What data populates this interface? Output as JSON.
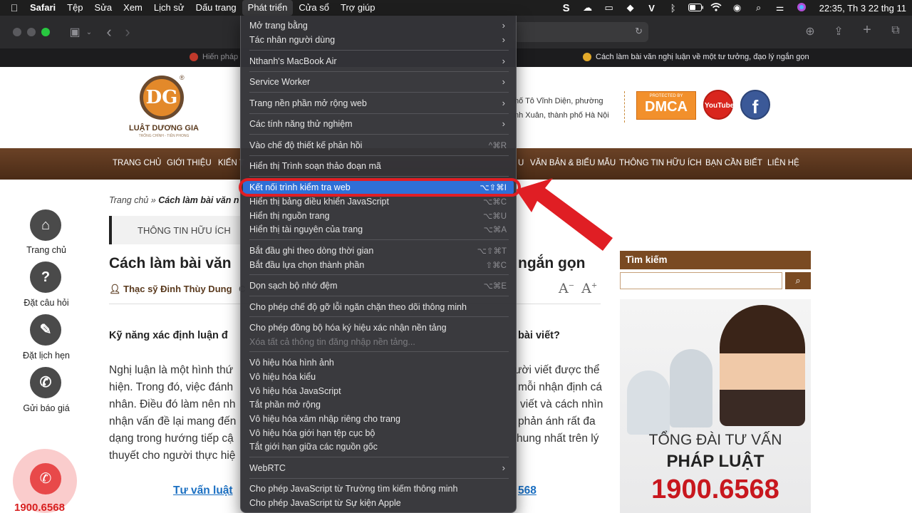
{
  "menubar": {
    "app": "Safari",
    "items": [
      "Tệp",
      "Sửa",
      "Xem",
      "Lịch sử",
      "Dấu trang",
      "Phát triển",
      "Cửa sổ",
      "Trợ giúp"
    ],
    "active": "Phát triển",
    "clock": "22:35, Th 3 22 thg 11",
    "status_icons": [
      "s-icon",
      "creative-cloud-icon",
      "notification-icon",
      "dropbox-icon",
      "v-icon",
      "bluetooth-icon",
      "battery-icon",
      "wifi-icon",
      "user-icon",
      "search-icon",
      "control-center-icon",
      "siri-icon"
    ]
  },
  "tabs": {
    "tab1": "Hiến pháp",
    "tab2": "Cách làm bài văn nghị luận về một tư tưởng, đạo lý ngắn gọn"
  },
  "header": {
    "logo_name": "LUẬT DƯƠNG GIA",
    "logo_tagline": "TRỐNG CHÍNH - TIÊN PHONG",
    "logo_reg": "®",
    "address_line1": "hố Tô Vĩnh Diện, phường",
    "address_line2": "nh Xuân, thành phố Hà Nội",
    "dmca_top": "PROTECTED BY",
    "dmca": "DMCA",
    "youtube": "YouTube",
    "facebook": "f"
  },
  "nav": {
    "items": [
      "TRANG CHỦ",
      "GIỚI THIỆU",
      "KIẾN T",
      "U",
      "VĂN BẢN & BIỂU MẪU",
      "THÔNG TIN HỮU ÍCH",
      "BẠN CẦN BIẾT",
      "LIÊN HỆ"
    ]
  },
  "left_sidebar": {
    "home": "Trang chủ",
    "ask": "Đặt câu hỏi",
    "appointment": "Đặt lịch hẹn",
    "quote": "Gửi báo giá",
    "phone": "1900.6568"
  },
  "article": {
    "breadcrumb_home": "Trang chủ »",
    "breadcrumb_current": "Cách làm bài văn n",
    "category": "THÔNG TIN HỮU ÍCH",
    "title_left": "Cách làm bài văn",
    "title_right": "ngắn gọn",
    "author": "Thạc sỹ Đinh Thùy Dung",
    "author_rest": "C",
    "font_small": "A",
    "font_large": "A",
    "question_left": "Kỹ năng xác định luận đ",
    "question_right": "bài viết?",
    "para_left": [
      "Nghị luận là một hình thứ",
      "hiện. Trong đó, việc đánh",
      "nhân. Điều đó làm nên nh",
      "nhận vấn đề lại mang đến",
      "dạng trong hướng tiếp cậ",
      "thuyết cho người thực hiệ"
    ],
    "para_right": [
      "ười viết được thể",
      "mỗi nhận định cá",
      "viết và cách nhìn",
      "phản ánh rất đa",
      "hung nhất trên lý",
      ""
    ],
    "link_left": "Tư vấn luật",
    "link_right": "568"
  },
  "right_sidebar": {
    "search_title": "Tìm kiếm",
    "search_placeholder": "",
    "ad_line1": "TỔNG ĐÀI TƯ VẤN",
    "ad_line2": "PHÁP LUẬT",
    "ad_line3": "1900.6568"
  },
  "dropdown": {
    "items": [
      {
        "label": "Mở trang bằng",
        "submenu": true
      },
      {
        "label": "Tác nhân người dùng",
        "submenu": true
      },
      {
        "label": "Nthanh's MacBook Air",
        "submenu": true
      },
      {
        "label": "Service Worker",
        "submenu": true
      },
      {
        "label": "Trang nền phần mở rộng web",
        "submenu": true
      },
      {
        "label": "Các tính năng thử nghiệm",
        "submenu": true
      },
      {
        "label": "Vào chế độ thiết kế phản hồi",
        "shortcut": "^⌘R"
      },
      {
        "label": "Hiển thị Trình soạn thảo đoạn mã"
      },
      {
        "label": "Kết nối trình kiểm tra web",
        "shortcut": "⌥⇧⌘I",
        "highlighted": true
      },
      {
        "label": "Hiển thị bảng điều khiển JavaScript",
        "shortcut": "⌥⌘C"
      },
      {
        "label": "Hiển thị nguồn trang",
        "shortcut": "⌥⌘U"
      },
      {
        "label": "Hiển thị tài nguyên của trang",
        "shortcut": "⌥⌘A"
      },
      {
        "label": "Bắt đầu ghi theo dòng thời gian",
        "shortcut": "⌥⇧⌘T"
      },
      {
        "label": "Bắt đầu lựa chọn thành phần",
        "shortcut": "⇧⌘C"
      },
      {
        "label": "Dọn sạch bộ nhớ đệm",
        "shortcut": "⌥⌘E"
      },
      {
        "label": "Cho phép chế độ gỡ lỗi ngăn chặn theo dõi thông minh"
      },
      {
        "label": "Cho phép đồng bộ hóa ký hiệu xác nhận nền tảng"
      },
      {
        "label": "Xóa tất cả thông tin đăng nhập nền tảng...",
        "disabled": true
      },
      {
        "label": "Vô hiệu hóa hình ảnh"
      },
      {
        "label": "Vô hiệu hóa kiểu"
      },
      {
        "label": "Vô hiệu hóa JavaScript"
      },
      {
        "label": "Tắt phần mở rộng"
      },
      {
        "label": "Vô hiệu hóa xâm nhập riêng cho trang"
      },
      {
        "label": "Vô hiệu hóa giới hạn tệp cục bộ"
      },
      {
        "label": "Tắt giới hạn giữa các nguồn gốc"
      },
      {
        "label": "WebRTC",
        "submenu": true
      },
      {
        "label": "Cho phép JavaScript từ Trường tìm kiếm thông minh"
      },
      {
        "label": "Cho phép JavaScript từ Sự kiện Apple"
      }
    ]
  },
  "annotation_color": "#e01e24",
  "highlight_color": "#2f6fd6"
}
